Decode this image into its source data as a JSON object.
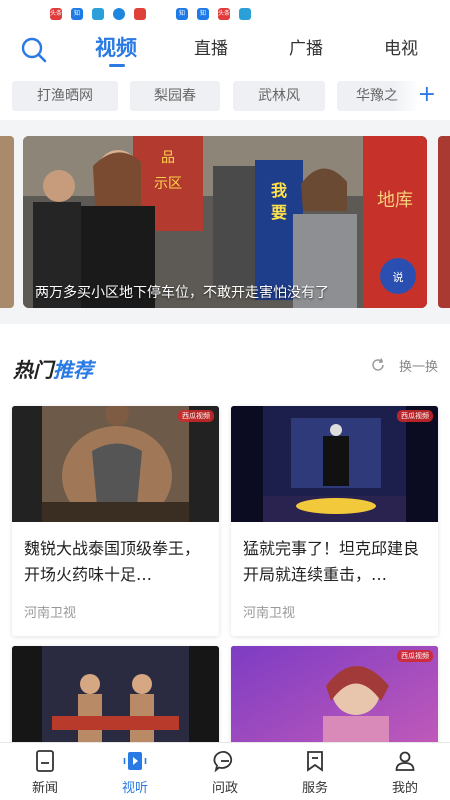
{
  "status_bar": {
    "icons": [
      {
        "name": "toutiao-icon",
        "text": "头条",
        "color": "#e03a3a"
      },
      {
        "name": "zhihu-icon",
        "text": "知",
        "color": "#1e7ae6"
      },
      {
        "name": "feather-icon",
        "text": "",
        "color": "#2a9fd8"
      },
      {
        "name": "browser-icon",
        "text": "",
        "color": "#1c86e0"
      },
      {
        "name": "news-icon",
        "text": "",
        "color": "#e0403a"
      },
      {
        "name": "zhihu-icon-2",
        "text": "知",
        "color": "#1e7ae6"
      },
      {
        "name": "zhihu-icon-3",
        "text": "知",
        "color": "#1e7ae6"
      },
      {
        "name": "toutiao-icon-2",
        "text": "头条",
        "color": "#e03a3a"
      },
      {
        "name": "feather-icon-2",
        "text": "",
        "color": "#2a9fd8"
      }
    ]
  },
  "top_tabs": [
    "视频",
    "直播",
    "广播",
    "电视"
  ],
  "category_chips": [
    "打渔晒网",
    "梨园春",
    "武林风",
    "华豫之"
  ],
  "banner": {
    "caption": "两万多买小区地下停车位，不敢开走害怕没有了"
  },
  "hot_section": {
    "title_part1": "热门",
    "title_part2": "推荐",
    "refresh_label": "换一换"
  },
  "videos": [
    {
      "title": "魏锐大战泰国顶级拳王，开场火药味十足…",
      "source": "河南卫视",
      "thumb_logo": "西瓜视频"
    },
    {
      "title": "猛就完事了！坦克邱建良开局就连续重击，…",
      "source": "河南卫视",
      "thumb_logo": "西瓜视频"
    },
    {
      "title": "",
      "source": "",
      "thumb_logo": ""
    },
    {
      "title": "",
      "source": "",
      "thumb_logo": "西瓜视频"
    }
  ],
  "bottom_tabs": [
    "新闻",
    "视听",
    "问政",
    "服务",
    "我的"
  ],
  "colors": {
    "accent": "#2a7ae4",
    "text": "#222222",
    "muted": "#999999"
  }
}
